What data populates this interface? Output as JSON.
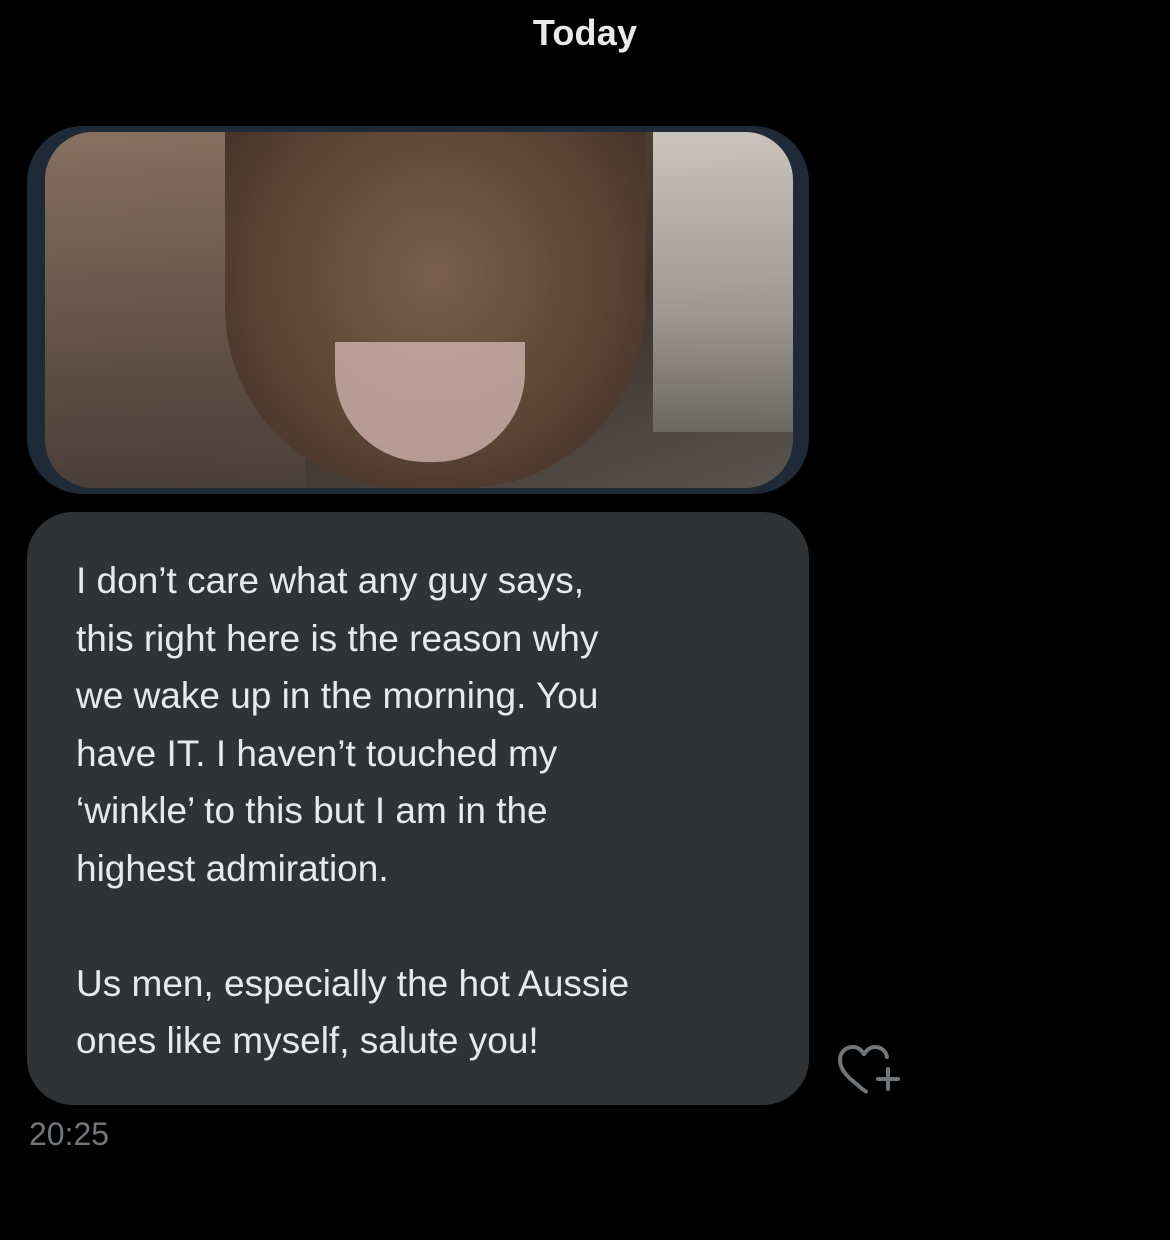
{
  "conversation": {
    "date_divider": "Today",
    "messages": [
      {
        "type": "image",
        "image": "photo"
      },
      {
        "type": "text",
        "paragraphs": [
          "I don’t care what any guy says,\nthis right here is the reason why\nwe wake up in the morning. You\nhave IT. I haven’t touched my\n‘winkle’ to this but I am in the\nhighest admiration.",
          "Us men, especially the hot Aussie\nones like myself, salute you!"
        ],
        "timestamp": "20:25",
        "reaction_icon": "heart-plus-icon"
      }
    ]
  },
  "colors": {
    "background": "#000000",
    "bubble": "#2f3336",
    "text": "#e7e9ea",
    "muted": "#71767b",
    "image_frame": "#1e2a37"
  }
}
